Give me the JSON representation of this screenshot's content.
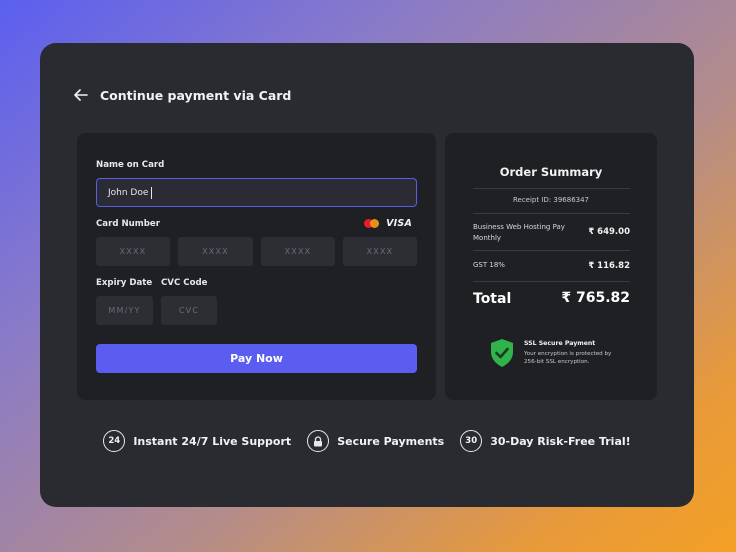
{
  "header": {
    "title": "Continue payment via Card",
    "back_icon": "arrow-left-icon"
  },
  "card_form": {
    "name_label": "Name on Card",
    "name_value": "John Doe",
    "card_number_label": "Card Number",
    "card_brand_visa": "VISA",
    "card_number_placeholders": [
      "XXXX",
      "XXXX",
      "XXXX",
      "XXXX"
    ],
    "expiry_label": "Expiry Date",
    "expiry_placeholder": "MM/YY",
    "cvc_label": "CVC Code",
    "cvc_placeholder": "CVC",
    "pay_button": "Pay Now"
  },
  "order_summary": {
    "title": "Order Summary",
    "receipt": "Receipt ID: 39686347",
    "items": [
      {
        "label": "Business Web Hosting Pay Monthly",
        "value": "₹ 649.00"
      },
      {
        "label": "GST 18%",
        "value": "₹ 116.82"
      }
    ],
    "total_label": "Total",
    "total_value": "₹ 765.82",
    "ssl_title": "SSL Secure Payment",
    "ssl_text": "Your encryption is protected by 256-bit SSL encryption."
  },
  "features": [
    {
      "icon": "24",
      "label": "Instant 24/7 Live Support"
    },
    {
      "icon": "lock-icon",
      "label": "Secure Payments"
    },
    {
      "icon": "30",
      "label": "30-Day Risk-Free Trial!"
    }
  ],
  "colors": {
    "accent": "#5b5cf0",
    "panel": "#1f2024",
    "window": "#2a2b31",
    "shield": "#2fb34a"
  }
}
